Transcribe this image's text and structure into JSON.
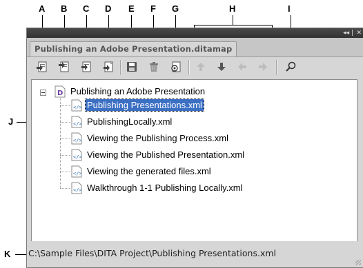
{
  "callouts": {
    "A": "A",
    "B": "B",
    "C": "C",
    "D": "D",
    "E": "E",
    "F": "F",
    "G": "G",
    "H": "H",
    "I": "I",
    "J": "J",
    "K": "K"
  },
  "panel": {
    "tab_title": "Publishing an Adobe Presentation.ditamap",
    "collapse_icon": "double-arrow-icon",
    "close_icon": "close-icon"
  },
  "toolbar": {
    "buttons": [
      {
        "name": "insert-before-icon"
      },
      {
        "name": "insert-after-icon"
      },
      {
        "name": "insert-child-icon"
      },
      {
        "name": "insert-reference-icon"
      },
      {
        "name": "save-icon"
      },
      {
        "name": "delete-icon"
      },
      {
        "name": "preview-icon"
      },
      {
        "name": "move-up-icon"
      },
      {
        "name": "move-down-icon"
      },
      {
        "name": "move-left-icon"
      },
      {
        "name": "move-right-icon"
      },
      {
        "name": "search-icon"
      }
    ]
  },
  "tree": {
    "root": "Publishing an Adobe Presentation",
    "children": [
      "Publishing Presentations.xml",
      "PublishingLocally.xml",
      "Viewing the Publishing Process.xml",
      "Viewing the Published Presentation.xml",
      "Viewing the generated files.xml",
      "Walkthrough 1-1 Publishing Locally.xml"
    ],
    "selected_index": 0
  },
  "status": {
    "path": "C:\\Sample Files\\DITA Project\\Publishing Presentations.xml"
  },
  "colors": {
    "selection": "#3b6fc4",
    "panel": "#d6d6d6",
    "titlebar": "#3a3a3a"
  }
}
